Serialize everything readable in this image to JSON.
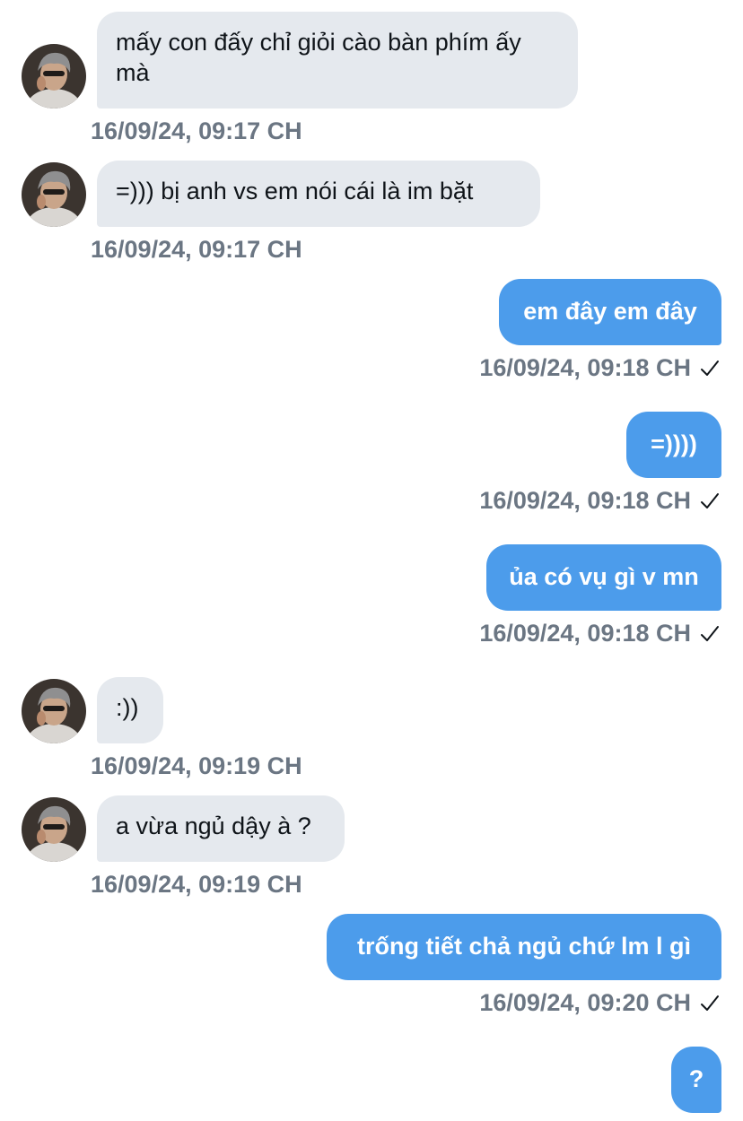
{
  "messages": [
    {
      "direction": "incoming",
      "text": "mấy con đấy chỉ giỏi cào bàn phím ấy mà",
      "time": "16/09/24, 09:17 CH"
    },
    {
      "direction": "incoming",
      "text": "=))) bị anh vs em nói cái là im bặt",
      "time": "16/09/24, 09:17 CH"
    },
    {
      "direction": "outgoing",
      "text": "em đây em đây",
      "time": "16/09/24, 09:18 CH",
      "status_icon": "check-icon"
    },
    {
      "direction": "outgoing",
      "text": "=))))",
      "time": "16/09/24, 09:18 CH",
      "status_icon": "check-icon"
    },
    {
      "direction": "outgoing",
      "text": "ủa có vụ gì v mn",
      "time": "16/09/24, 09:18 CH",
      "status_icon": "check-icon"
    },
    {
      "direction": "incoming",
      "text": ":))",
      "time": "16/09/24, 09:19 CH"
    },
    {
      "direction": "incoming",
      "text": "a vừa ngủ dậy à ?",
      "time": "16/09/24, 09:19 CH"
    },
    {
      "direction": "outgoing",
      "text": "trống tiết chả ngủ chứ lm l gì",
      "time": "16/09/24, 09:20 CH",
      "status_icon": "check-icon"
    },
    {
      "direction": "outgoing",
      "text": "?"
    }
  ],
  "colors": {
    "incoming_bubble": "#e5e9ee",
    "outgoing_bubble": "#4c9ceb",
    "timestamp": "#6b7683"
  }
}
